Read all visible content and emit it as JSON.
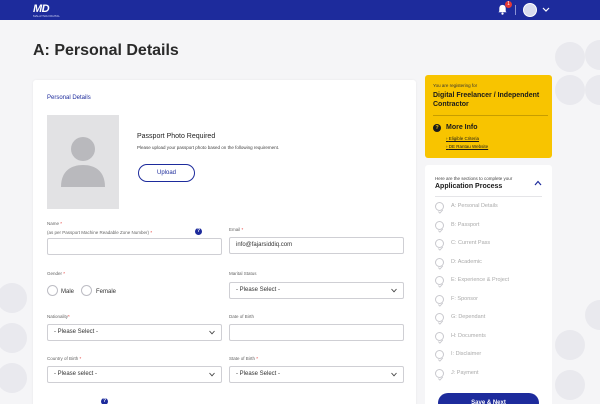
{
  "brand": {
    "logo_text": "MD",
    "logo_sub": "MALAYSIA DIGITAL"
  },
  "topbar": {
    "notification_count": "1"
  },
  "page": {
    "title": "A: Personal Details"
  },
  "form": {
    "section_label": "Personal Details",
    "photo": {
      "title": "Passport Photo Required",
      "note": "Please upload your passport photo based on the following requirement.",
      "upload_label": "Upload"
    },
    "name": {
      "label": "Name",
      "sublabel": "(as per Passport Machine Readable Zone Number)",
      "value": ""
    },
    "email": {
      "label": "Email",
      "value": "info@fajarsiddiq.com"
    },
    "gender": {
      "label": "Gender",
      "options": [
        "Male",
        "Female"
      ]
    },
    "marital_status": {
      "label": "Marital Status",
      "value": "- Please Select -"
    },
    "nationality": {
      "label": "Nationality",
      "value": "- Please Select -"
    },
    "date_of_birth": {
      "label": "Date of Birth",
      "value": ""
    },
    "country_of_birth": {
      "label": "Country of Birth",
      "value": "- Please select -"
    },
    "state_of_birth": {
      "label": "State of Birth",
      "value": "- Please Select -"
    }
  },
  "registration": {
    "intro": "You are registering for",
    "program": "Digital Freelancer / Independent Contractor",
    "more_info_label": "More Info",
    "links": [
      "Eligible Criteria",
      "DE Rantau Website"
    ]
  },
  "process": {
    "intro": "Here are the sections to complete your",
    "title": "Application Process",
    "steps": [
      "A: Personal Details",
      "B: Passport",
      "C: Current Pass",
      "D: Academic",
      "E: Experience & Project",
      "F: Sponsor",
      "G: Dependant",
      "H: Documents",
      "I: Disclaimer",
      "J: Payment"
    ]
  },
  "actions": {
    "save_next_label": "Save & Next"
  },
  "colors": {
    "primary": "#1d2b9c",
    "accent": "#f8c400",
    "required": "#e53935"
  }
}
